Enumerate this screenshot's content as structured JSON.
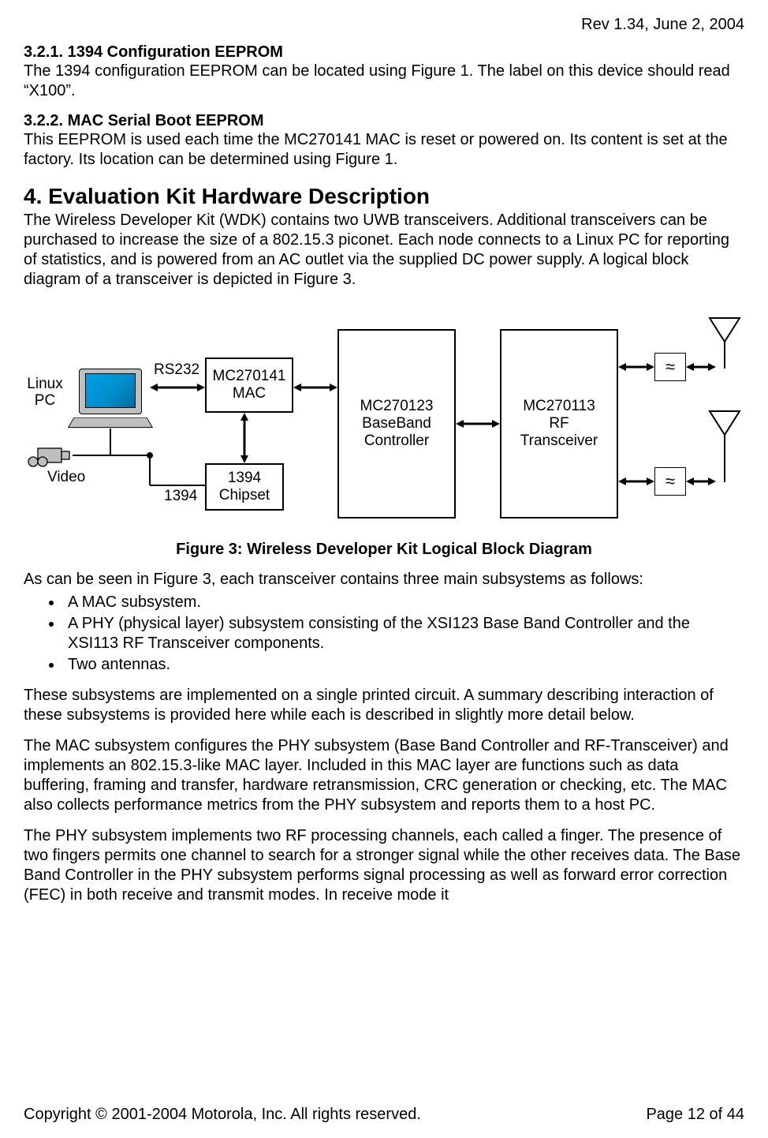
{
  "header": {
    "rev": "Rev 1.34, June 2, 2004"
  },
  "s321": {
    "title": "3.2.1.  1394 Configuration EEPROM",
    "body": "The 1394 configuration EEPROM can be located using Figure 1. The label on this device should read “X100”."
  },
  "s322": {
    "title": "3.2.2.  MAC Serial Boot EEPROM",
    "body": "This EEPROM is used each time the MC270141 MAC is reset or powered on. Its content is set at the factory. Its location can be determined using Figure 1."
  },
  "s4": {
    "title": "4.    Evaluation Kit Hardware Description",
    "intro": "The Wireless Developer Kit (WDK) contains two UWB transceivers. Additional transceivers can be purchased to increase the size of a 802.15.3 piconet. Each node connects to a Linux PC for reporting of statistics, and is powered from an AC outlet via the supplied DC power supply. A logical block diagram of a transceiver is depicted in Figure 3."
  },
  "figure3": {
    "caption": "Figure 3: Wireless Developer Kit Logical Block Diagram",
    "linuxpc": "Linux\nPC",
    "rs232": "RS232",
    "mac_l1": "MC270141",
    "mac_l2": "MAC",
    "chip_l1": "1394",
    "chip_l2": "Chipset",
    "port1394": "1394",
    "video": "Video",
    "bb_l1": "MC270123",
    "bb_l2": "BaseBand",
    "bb_l3": "Controller",
    "rf_l1": "MC270113",
    "rf_l2": "RF",
    "rf_l3": "Transceiver",
    "filter": "≈"
  },
  "after_fig_intro": "As can be seen in Figure 3, each transceiver contains three main subsystems as follows:",
  "bullets": [
    "A MAC subsystem.",
    "A PHY (physical layer) subsystem consisting of the XSI123 Base Band Controller and the XSI113 RF Transceiver components.",
    "Two antennas."
  ],
  "para_summary": "These subsystems are implemented on a single printed circuit. A summary describing interaction of these subsystems is provided here while each is described in slightly more detail below.",
  "para_mac": "The MAC subsystem configures the PHY subsystem (Base Band Controller and RF-Transceiver) and implements an 802.15.3-like MAC layer. Included in this MAC layer are functions such as data buffering, framing and transfer, hardware retransmission, CRC generation or checking, etc. The MAC also collects performance metrics from the PHY subsystem and reports them to a host PC.",
  "para_phy": "The PHY subsystem implements two RF processing channels, each called a finger. The presence of two fingers permits one channel to search for a stronger signal while the other receives data. The Base Band Controller in the PHY subsystem performs signal processing as well as forward error correction (FEC) in both receive and transmit modes. In receive mode it",
  "footer": {
    "copyright": "Copyright © 2001-2004 Motorola, Inc. All rights reserved.",
    "page": "Page 12 of 44"
  }
}
